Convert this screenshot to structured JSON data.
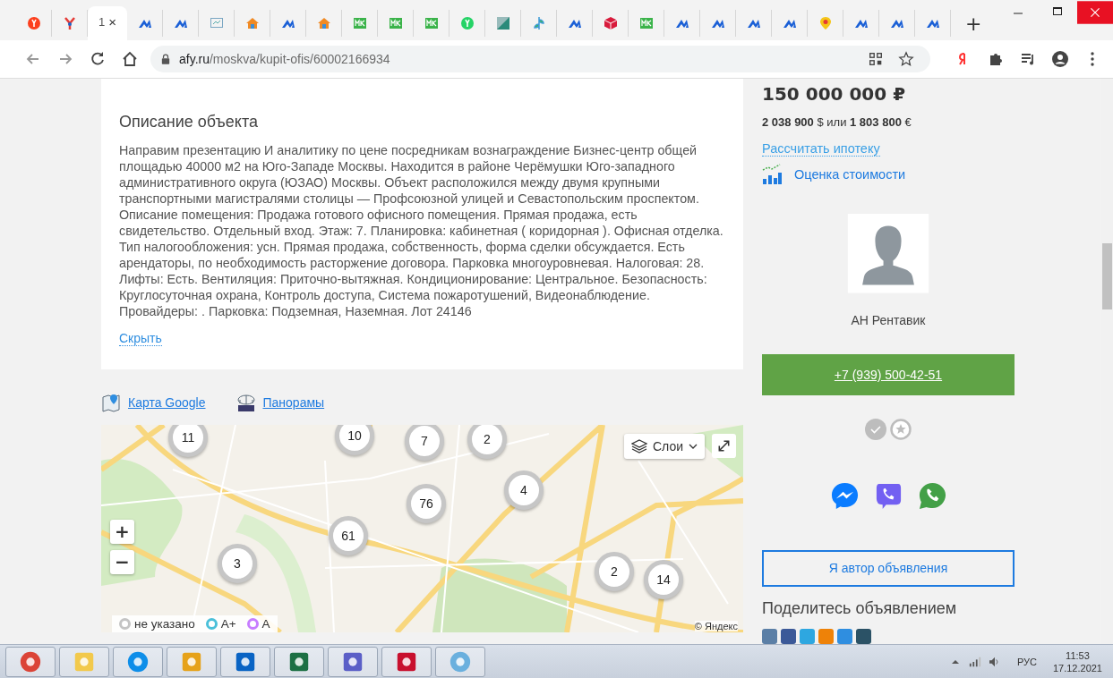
{
  "browser": {
    "tabs": [
      {
        "kind": "yandex",
        "selected": false
      },
      {
        "kind": "tool",
        "selected": false
      },
      {
        "label": "1",
        "close": "×",
        "selected": true
      },
      {
        "kind": "af",
        "selected": false
      },
      {
        "kind": "af",
        "selected": false
      },
      {
        "kind": "chart",
        "selected": false
      },
      {
        "kind": "home",
        "selected": false
      },
      {
        "kind": "af",
        "selected": false
      },
      {
        "kind": "home",
        "selected": false
      },
      {
        "kind": "mk",
        "selected": false
      },
      {
        "kind": "mk",
        "selected": false
      },
      {
        "kind": "mk",
        "selected": false
      },
      {
        "kind": "whatsapp",
        "selected": false
      },
      {
        "kind": "square",
        "selected": false
      },
      {
        "kind": "leaf",
        "selected": false
      },
      {
        "kind": "af",
        "selected": false
      },
      {
        "kind": "cube",
        "selected": false
      },
      {
        "kind": "mk",
        "selected": false
      },
      {
        "kind": "af",
        "selected": false
      },
      {
        "kind": "af",
        "selected": false
      },
      {
        "kind": "af",
        "selected": false
      },
      {
        "kind": "af",
        "selected": false
      },
      {
        "kind": "pin",
        "selected": false
      },
      {
        "kind": "af",
        "selected": false
      },
      {
        "kind": "af",
        "selected": false
      },
      {
        "kind": "af",
        "selected": false
      }
    ],
    "new_tab": "+",
    "address": {
      "host": "afy.ru",
      "path": "/moskva/kupit-ofis/60002166934"
    }
  },
  "description": {
    "title": "Описание объекта",
    "text": "Направим презентацию И аналитику по цене посредникам вознаграждение Бизнес-центр общей площадью 40000 м2 на Юго-Западе Москвы. Находится в районе Черёмушки Юго-западного административного округа (ЮЗАО) Москвы. Объект расположился между двумя крупными транспортными магистралями столицы — Профсоюзной улицей и Севастопольским проспектом. Описание помещения: Продажа готового офисного помещения. Прямая продажа, есть свидетельство. Отдельный вход. Этаж: 7. Планировка: кабинетная ( коридорная ). Офисная отделка. Тип налогообложения: усн. Прямая продажа, собственность, форма сделки обсуждается. Есть арендаторы, по необходимость расторжение договора. Парковка многоуровневая. Налоговая: 28. Лифты: Есть. Вентиляция: Приточно-вытяжная. Кондиционирование: Центральное. Безопасность: Круглосуточная охрана, Контроль доступа, Система пожаротушений, Видеонаблюдение. Провайдеры: . Парковка: Подземная, Наземная. Лот 24146",
    "toggle": "Скрыть"
  },
  "map_links": [
    {
      "kind": "map",
      "label": "Карта Google"
    },
    {
      "kind": "panorama",
      "label": "Панорамы"
    }
  ],
  "map": {
    "clusters": [
      "11",
      "10",
      "7",
      "2",
      "4",
      "76",
      "61",
      "3",
      "2",
      "14"
    ],
    "zoom_in": "+",
    "zoom_out": "−",
    "layers": "Слои",
    "legend": [
      {
        "label": "не указано",
        "color": "#c4c4c4"
      },
      {
        "label": "А+",
        "color": "#4bc0d9"
      },
      {
        "label": "А",
        "color": "#c77dff"
      }
    ],
    "attribution": "© Яндекс"
  },
  "listing": {
    "price": "150 000 000 ₽",
    "conversion": "**2 038 900** $ или **1 803 800** €",
    "mortgage_link": "Рассчитать ипотеку",
    "valuation_link": "Оценка стоимости",
    "agent": "АН Рентавик",
    "phone": "+7 (939) 500-42-51",
    "messengers": [
      {
        "kind": "messenger"
      },
      {
        "kind": "viber"
      },
      {
        "kind": "whatsapp"
      }
    ],
    "author_button": "Я автор объявления",
    "share_title": "Поделитесь объявлением",
    "share": [
      {
        "kind": "vk"
      },
      {
        "kind": "facebook"
      },
      {
        "kind": "twitter"
      },
      {
        "kind": "ok"
      },
      {
        "kind": "mail"
      },
      {
        "kind": "livejournal"
      }
    ]
  },
  "taskbar": {
    "apps": [
      {
        "kind": "chrome"
      },
      {
        "kind": "explorer"
      },
      {
        "kind": "teamviewer"
      },
      {
        "kind": "dynamics"
      },
      {
        "kind": "outlook"
      },
      {
        "kind": "excel"
      },
      {
        "kind": "teams"
      },
      {
        "kind": "acrobat"
      },
      {
        "kind": "paint"
      }
    ],
    "language": "РУС",
    "time": "11:53",
    "date": "17.12.2021"
  }
}
